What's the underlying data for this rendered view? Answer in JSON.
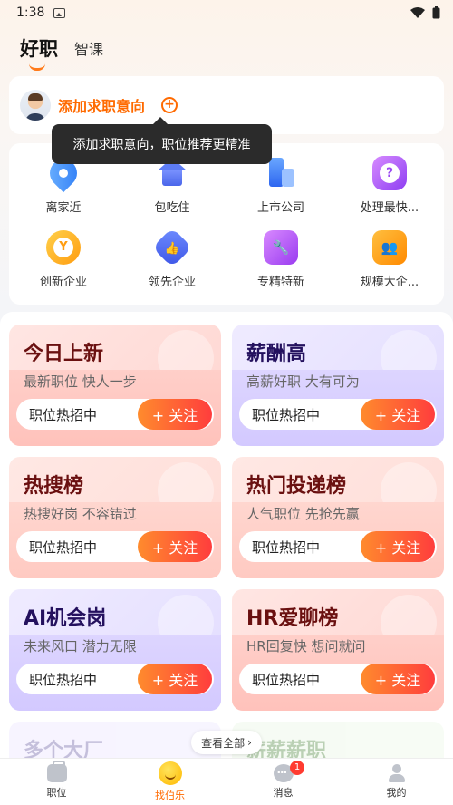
{
  "status_bar": {
    "time": "1:38",
    "icons": [
      "gallery-icon",
      "wifi-icon",
      "battery-icon"
    ]
  },
  "header": {
    "tabs": [
      {
        "label": "好职",
        "active": true
      },
      {
        "label": "智课",
        "active": false
      }
    ]
  },
  "intent": {
    "label": "添加求职意向",
    "tooltip": "添加求职意向，职位推荐更精准"
  },
  "categories": [
    {
      "label": "离家近",
      "icon": "location-pin-icon"
    },
    {
      "label": "包吃住",
      "icon": "house-icon"
    },
    {
      "label": "上市公司",
      "icon": "building-icon"
    },
    {
      "label": "处理最快...",
      "icon": "question-icon"
    },
    {
      "label": "创新企业",
      "icon": "coin-y-icon",
      "glyph": "Y"
    },
    {
      "label": "领先企业",
      "icon": "thumbs-up-icon",
      "glyph": "👍"
    },
    {
      "label": "专精特新",
      "icon": "wrench-icon",
      "glyph": "🔧"
    },
    {
      "label": "规模大企...",
      "icon": "people-icon",
      "glyph": "👥"
    }
  ],
  "rank_cards": [
    {
      "title": "今日上新",
      "subtitle": "最新职位 快人一步",
      "pill": "职位热招中",
      "button": "+ 关注"
    },
    {
      "title": "薪酬高",
      "subtitle": "高薪好职 大有可为",
      "pill": "职位热招中",
      "button": "+ 关注"
    },
    {
      "title": "热搜榜",
      "subtitle": "热搜好岗 不容错过",
      "pill": "职位热招中",
      "button": "+ 关注"
    },
    {
      "title": "热门投递榜",
      "subtitle": "人气职位 先抢先赢",
      "pill": "职位热招中",
      "button": "+ 关注"
    },
    {
      "title": "AI机会岗",
      "subtitle": "未来风口 潜力无限",
      "pill": "职位热招中",
      "button": "+ 关注"
    },
    {
      "title": "HR爱聊榜",
      "subtitle": "HR回复快 想问就问",
      "pill": "职位热招中",
      "button": "+ 关注"
    }
  ],
  "peek": [
    "多个大厂",
    "薪薪薪职"
  ],
  "view_all": "查看全部",
  "bottom_nav": [
    {
      "label": "职位",
      "icon": "briefcase-icon"
    },
    {
      "label": "找伯乐",
      "icon": "smiley-icon",
      "active": true
    },
    {
      "label": "消息",
      "icon": "chat-icon",
      "badge": "1"
    },
    {
      "label": "我的",
      "icon": "user-icon"
    }
  ],
  "colors": {
    "accent": "#ff6a00",
    "follow_gradient": [
      "#ff8b2d",
      "#ff3d3d"
    ]
  }
}
